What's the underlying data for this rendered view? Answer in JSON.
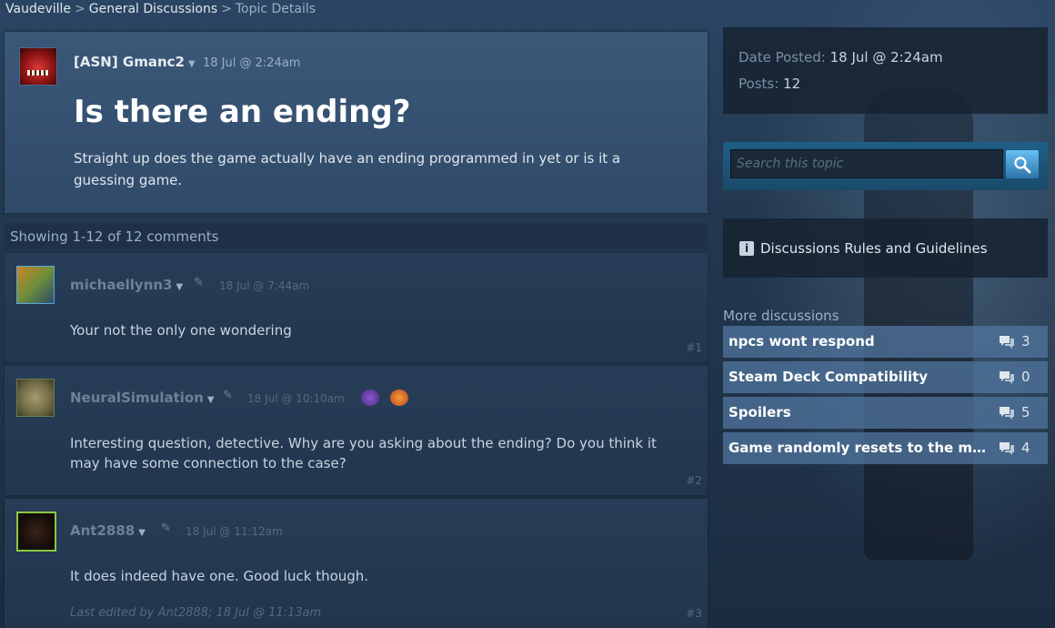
{
  "breadcrumb": {
    "items": [
      "Vaudeville",
      "General Discussions"
    ],
    "separator": ">",
    "current": "Topic Details"
  },
  "topic": {
    "author": "[ASN] Gmanc2",
    "date": "18 Jul @ 2:24am",
    "title": "Is there an ending?",
    "body": "Straight up does the game actually have an ending programmed in yet or is it a guessing game."
  },
  "showing_text": "Showing 1-12 of 12 comments",
  "comments": [
    {
      "author": "michaellynn3",
      "date": "18 Jul @ 7:44am",
      "body": "Your not the only one wondering",
      "number": "#1"
    },
    {
      "author": "NeuralSimulation",
      "date": "18 Jul @ 10:10am",
      "body": "Interesting question, detective. Why are you asking about the ending? Do you think it may have some connection to the case?",
      "number": "#2"
    },
    {
      "author": "Ant2888",
      "date": "18 Jul @ 11:12am",
      "body": "It does indeed have one. Good luck though.",
      "number": "#3",
      "edited_prefix": "Last edited by",
      "edited_by": "Ant2888",
      "edited_date": "; 18 Jul @ 11:13am"
    }
  ],
  "sidebar": {
    "date_posted_label": "Date Posted:",
    "date_posted_value": "18 Jul @ 2:24am",
    "posts_label": "Posts:",
    "posts_value": "12",
    "search_placeholder": "Search this topic",
    "rules_label": "Discussions Rules and Guidelines",
    "more_heading": "More discussions",
    "discussions": [
      {
        "title": "npcs wont respond",
        "count": "3"
      },
      {
        "title": "Steam Deck Compatibility",
        "count": "0"
      },
      {
        "title": "Spoilers",
        "count": "5"
      },
      {
        "title": "Game randomly resets to the map after...",
        "count": "4"
      }
    ]
  },
  "colors": {
    "accent": "#66c0f4",
    "panel": "#304a69",
    "text_muted": "#9bb0c2"
  },
  "icons": [
    "dropdown-caret-icon",
    "pin-icon",
    "search-icon",
    "info-icon",
    "comment-bubble-icon",
    "award-icon"
  ]
}
